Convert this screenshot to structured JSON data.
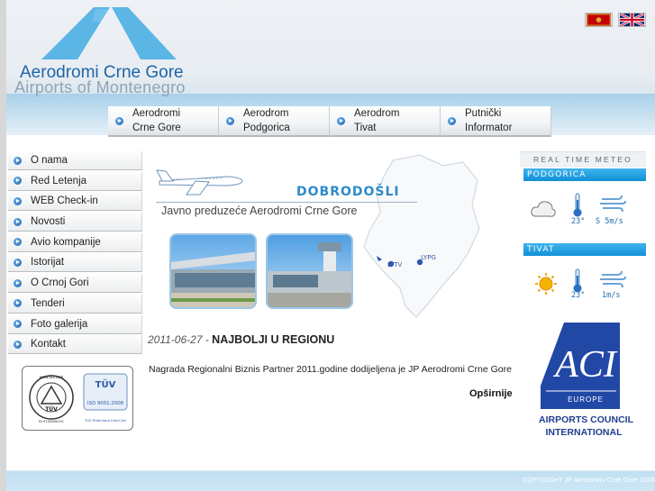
{
  "brand": {
    "title": "Aerodromi Crne Gore",
    "subtitle": "Airports of Montenegro"
  },
  "languages": [
    "montenegro-flag-icon",
    "uk-flag-icon"
  ],
  "topnav": [
    {
      "label": "Aerodromi\nCrne Gore"
    },
    {
      "label": "Aerodrom\nPodgorica"
    },
    {
      "label": "Aerodrom\nTivat"
    },
    {
      "label": "Putnički\nInformator"
    }
  ],
  "leftmenu": [
    {
      "label": "O nama"
    },
    {
      "label": "Red Letenja"
    },
    {
      "label": "WEB Check-in"
    },
    {
      "label": "Novosti"
    },
    {
      "label": "Avio kompanije"
    },
    {
      "label": "Istorijat"
    },
    {
      "label": "O Crnoj Gori"
    },
    {
      "label": "Tenderi"
    },
    {
      "label": "Foto galerija"
    },
    {
      "label": "Kontakt"
    }
  ],
  "certificates": {
    "tuv_left_top": "www.tuv.com",
    "tuv_left_brand": "TÜV",
    "tuv_left_bottom": "ID 9105060151",
    "tuv_right_brand": "TÜV",
    "tuv_right_cert": "ISO 9001:2008",
    "tuv_right_bottom": "TÜV Rheinland InterCert"
  },
  "welcome": {
    "title": "DOBRODOŠLI",
    "subtitle": "Javno preduzeće Aerodromi Crne Gore",
    "map_labels": [
      "LYTV",
      "LYPG"
    ]
  },
  "news": {
    "date": "2011-06-27",
    "separator": " - ",
    "title": "NAJBOLJI U REGIONU",
    "body": "Nagrada Regionalni Biznis Partner 2011.godine dodijeljena je JP Aerodromi Crne Gore",
    "more": "Opširnije"
  },
  "meteo": {
    "heading": "REAL TIME METEO",
    "cities": [
      {
        "name": "PODGORICA",
        "condition": "cloudy-icon",
        "temp": "23°",
        "wind": "S 5m/s"
      },
      {
        "name": "TIVAT",
        "condition": "sunny-icon",
        "temp": "23°",
        "wind": "1m/s"
      }
    ]
  },
  "aci": {
    "europe": "EUROPE",
    "line1": "AIRPORTS COUNCIL",
    "line2": "INTERNATIONAL"
  },
  "footer": {
    "copyright": "COPYRIGHT JP Aerodromi Crne Gore 2008"
  },
  "colors": {
    "brand_blue": "#1c66a8",
    "accent_blue": "#2e8ac9",
    "header_band": "#a9d0ea",
    "city_bar": "#1190d6"
  }
}
